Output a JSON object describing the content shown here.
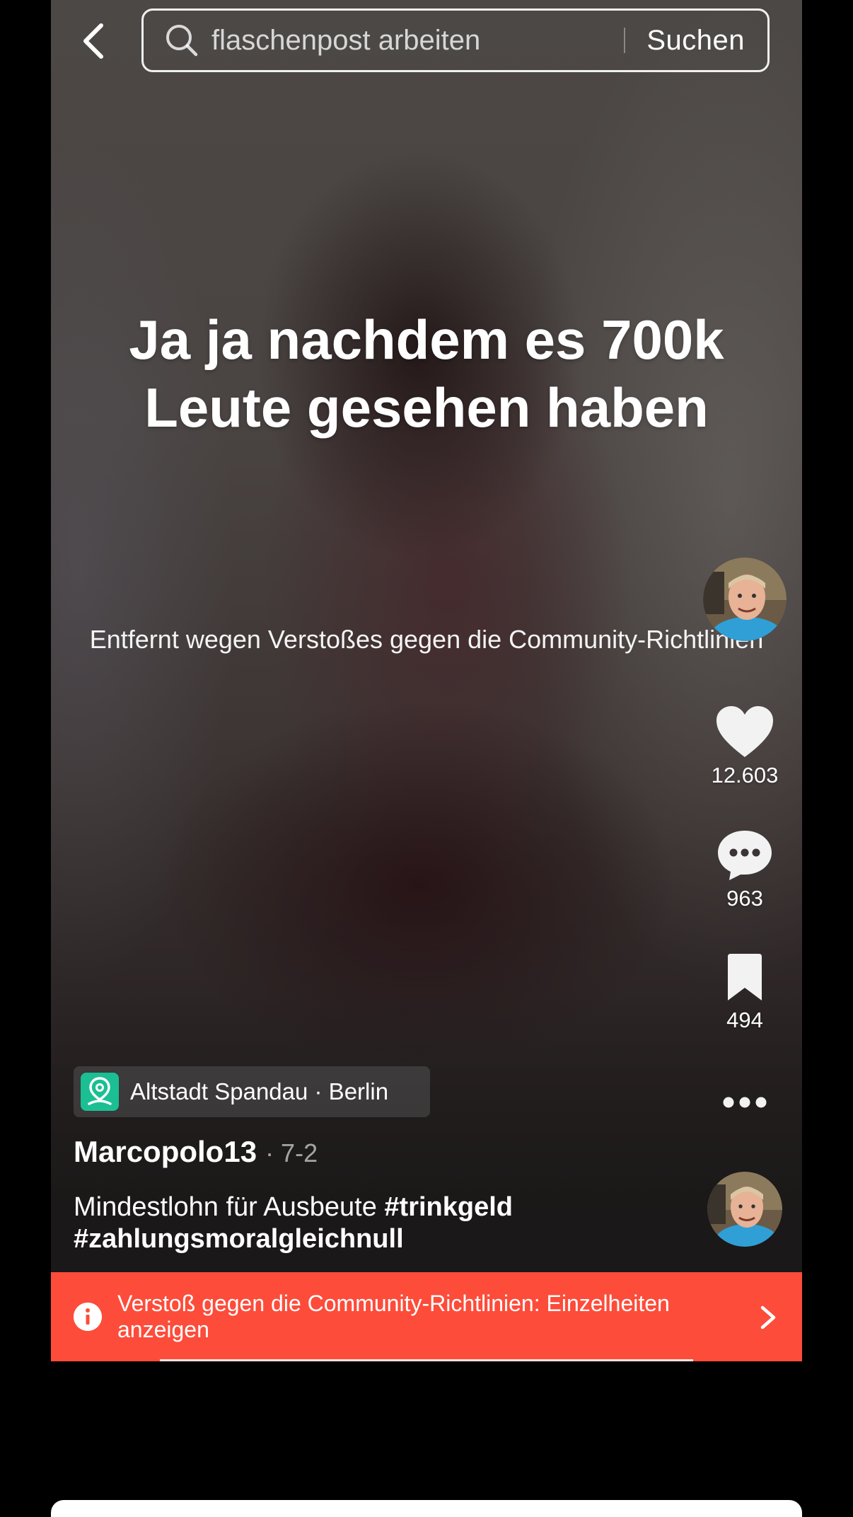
{
  "search": {
    "query": "flaschenpost arbeiten",
    "submit_label": "Suchen"
  },
  "video": {
    "overlay_title": "Ja ja nachdem es 700k Leute gesehen haben",
    "removed_notice": "Entfernt wegen Verstoßes gegen die Community-Richtlinien"
  },
  "actions": {
    "likes": "12.603",
    "comments": "963",
    "saves": "494"
  },
  "post": {
    "location": "Altstadt Spandau · Berlin",
    "username": "Marcopolo13",
    "date": "· 7-2",
    "caption_text": "Mindestlohn für Ausbeute",
    "hashtags": [
      "#trinkgeld",
      "#zahlungsmoralgleichnull"
    ]
  },
  "violation": {
    "text": "Verstoß gegen die Community-Richtlinien: Einzelheiten anzeigen",
    "color": "#fd4c3a"
  },
  "icons": [
    "back-icon",
    "search-icon",
    "heart-icon",
    "comment-icon",
    "bookmark-icon",
    "more-icon",
    "location-pin-icon",
    "info-icon",
    "chevron-right-icon"
  ]
}
